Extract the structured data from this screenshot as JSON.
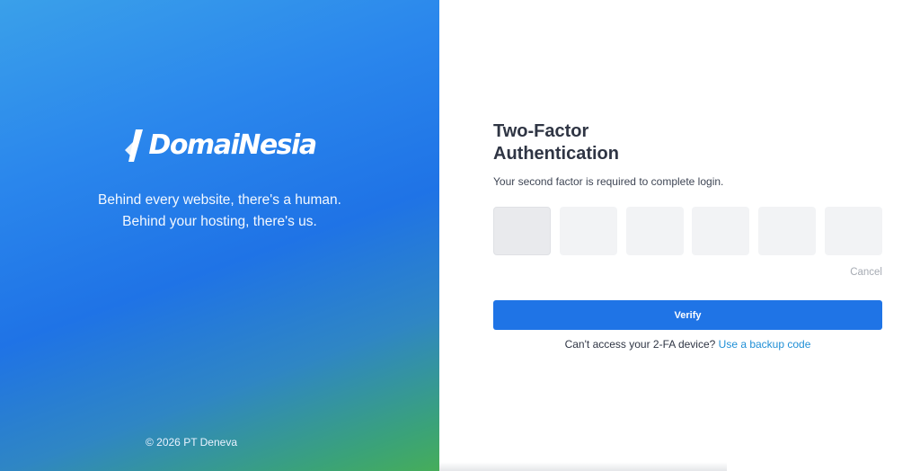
{
  "brand": {
    "logo_text": "DomaiNesia",
    "tagline_line1": "Behind every website, there's a human.",
    "tagline_line2": "Behind your hosting, there's us.",
    "copyright": "© 2026 PT Deneva"
  },
  "form": {
    "title": "Two-Factor Authentication",
    "subtitle": "Your second factor is required to complete login.",
    "otp_digits": [
      "",
      "",
      "",
      "",
      "",
      ""
    ],
    "cancel_label": "Cancel",
    "verify_label": "Verify",
    "backup_prompt": "Can't access your 2-FA device?",
    "backup_link": "Use a backup code"
  },
  "colors": {
    "accent": "#1f74e6",
    "link": "#1f8fd6",
    "title": "#2f3544"
  }
}
